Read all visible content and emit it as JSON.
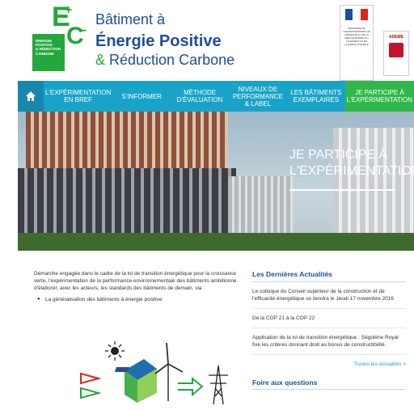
{
  "header": {
    "logo_box_lines": [
      "ÉNERGIE",
      "POSITIVE",
      "& RÉDUCTION",
      "CARBONE"
    ],
    "logo_e": "E",
    "logo_plus": "+",
    "logo_c": "C",
    "logo_minus": "−",
    "title_line1": "Bâtiment à",
    "title_line2": "Énergie Positive",
    "title_line3_amp": "& ",
    "title_line3": "Réduction Carbone",
    "gov_text": "MINISTÈRE DE L'ENVIRONNEMENT DE L'ÉNERGIE ET DE LA MER MINISTÈRE DU LOGEMENT ET DE L'HABITAT DURABLE",
    "ademe_label": "ADEME",
    "colors": {
      "brand_green": "#22a83c",
      "brand_blue": "#1d4e9c"
    }
  },
  "nav": {
    "home_icon": "home-icon",
    "items": [
      "L'expérimentation en bref",
      "S'informer",
      "Méthode d'évaluation",
      "Niveaux de performance & label",
      "Les bâtiments exemplaires",
      "Je participe à l'expérimentation"
    ],
    "active_index": 5,
    "colors": {
      "bar": "#1aa3c8",
      "active": "#2fb849"
    }
  },
  "hero": {
    "title_line1": "JE PARTICIPE À",
    "title_line2": "L'EXPÉRIMENTATION"
  },
  "main": {
    "intro": "Démarche engagée dans le cadre de la loi de transition énergétique pour la croissance verte, l'expérimentation de la performance environnementale des bâtiments ambitionne d'élaborer, avec les acteurs, les standards des bâtiments de demain, via :",
    "bullet": "La généralisation des bâtiments à énergie positive"
  },
  "news": {
    "heading": "Les Dernières Actualités",
    "items": [
      "Le colloque du Conseil supérieur de la construction et de l'efficacité énergétique se tiendra le Jeudi 17 novembre 2016",
      "De la COP 21 à la COP 22",
      "Application de la loi de transition énergétique : Ségolène Royal fixe les critères donnant droit au bonus de constructibilité."
    ],
    "more_link": "Toutes les actualités >",
    "faq_heading": "Foire aux questions"
  }
}
